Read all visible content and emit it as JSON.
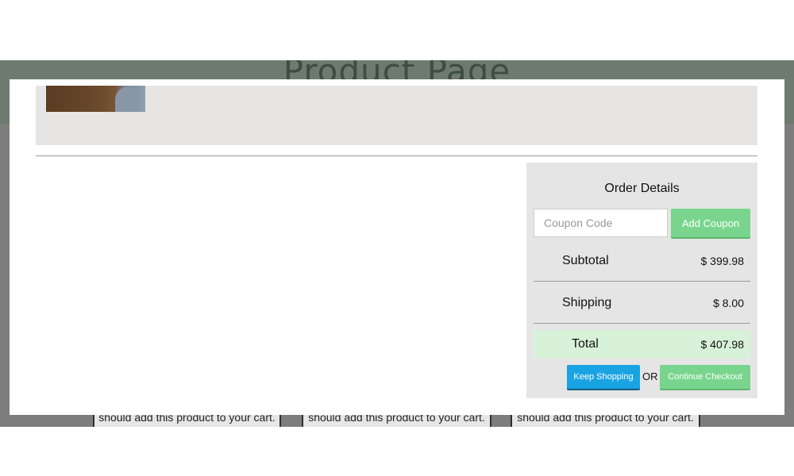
{
  "background_page": {
    "title": "Product Page",
    "card_text": [
      "should add this product to your cart.",
      "should add this product to your cart.",
      "should add this product to your cart."
    ]
  },
  "modal": {
    "order_details": {
      "title": "Order Details",
      "coupon_placeholder": "Coupon Code",
      "coupon_value": "",
      "add_coupon_label": "Add Coupon",
      "subtotal_label": "Subtotal",
      "subtotal_value": "$ 399.98",
      "shipping_label": "Shipping",
      "shipping_value": "$ 8.00",
      "total_label": "Total",
      "total_value": "$ 407.98",
      "keep_shopping_label": "Keep Shopping",
      "or_label": "OR",
      "continue_checkout_label": "Continue Checkout"
    }
  },
  "colors": {
    "accent_green": "#79d58d",
    "accent_blue": "#1aa3e3",
    "total_highlight": "#d8f2da",
    "panel_bg": "#e5e5e5"
  }
}
